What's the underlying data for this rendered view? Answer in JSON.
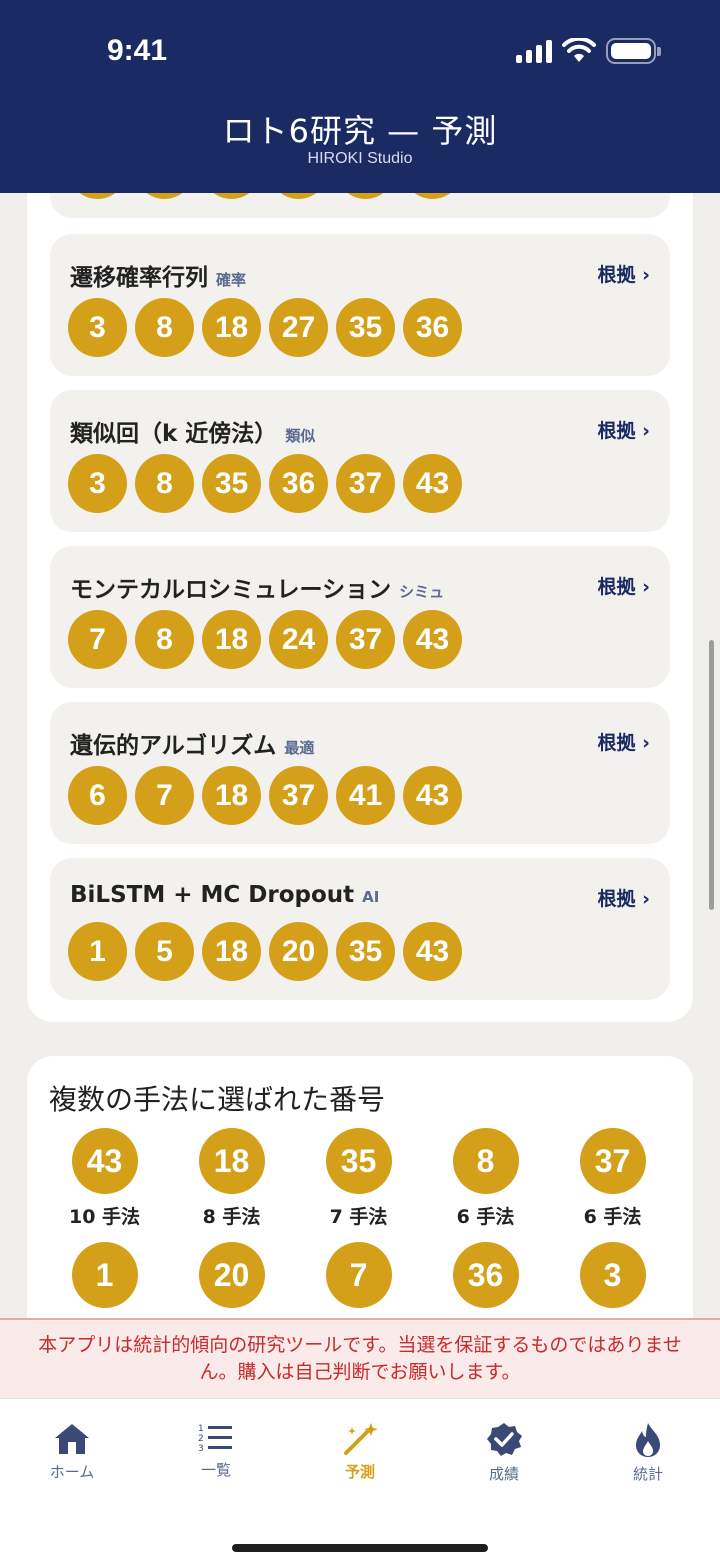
{
  "status": {
    "time": "9:41"
  },
  "header": {
    "title": "ロト6研究 — 予測",
    "subtitle": "HIROKI Studio"
  },
  "methods": [
    {
      "name": "遷移確率行列",
      "tag": "確率",
      "link": "根拠 ›",
      "numbers": [
        "3",
        "8",
        "18",
        "27",
        "35",
        "36"
      ]
    },
    {
      "name": "類似回（k 近傍法）",
      "tag": "類似",
      "link": "根拠 ›",
      "numbers": [
        "3",
        "8",
        "35",
        "36",
        "37",
        "43"
      ]
    },
    {
      "name": "モンテカルロシミュレーション",
      "tag": "シミュ",
      "link": "根拠 ›",
      "numbers": [
        "7",
        "8",
        "18",
        "24",
        "37",
        "43"
      ]
    },
    {
      "name": "遺伝的アルゴリズム",
      "tag": "最適",
      "link": "根拠 ›",
      "numbers": [
        "6",
        "7",
        "18",
        "37",
        "41",
        "43"
      ]
    },
    {
      "name": "BiLSTM + MC Dropout",
      "tag": "AI",
      "link": "根拠 ›",
      "numbers": [
        "1",
        "5",
        "18",
        "20",
        "35",
        "43"
      ]
    }
  ],
  "multi": {
    "title": "複数の手法に選ばれた番号",
    "row1": [
      {
        "number": "43",
        "count": "10 手法"
      },
      {
        "number": "18",
        "count": "8 手法"
      },
      {
        "number": "35",
        "count": "7 手法"
      },
      {
        "number": "8",
        "count": "6 手法"
      },
      {
        "number": "37",
        "count": "6 手法"
      }
    ],
    "row2": [
      {
        "number": "1"
      },
      {
        "number": "20"
      },
      {
        "number": "7"
      },
      {
        "number": "36"
      },
      {
        "number": "3"
      }
    ]
  },
  "disclaimer": "本アプリは統計的傾向の研究ツールです。当選を保証するものではありません。購入は自己判断でお願いします。",
  "tabs": [
    {
      "label": "ホーム",
      "icon": "home-icon"
    },
    {
      "label": "一覧",
      "icon": "list-icon"
    },
    {
      "label": "予測",
      "icon": "magic-wand-icon",
      "active": true
    },
    {
      "label": "成績",
      "icon": "check-badge-icon"
    },
    {
      "label": "統計",
      "icon": "flame-icon"
    }
  ],
  "colors": {
    "header": "#1a2a63",
    "ball": "#d4a019",
    "disclaimer": "#c72b2b"
  }
}
